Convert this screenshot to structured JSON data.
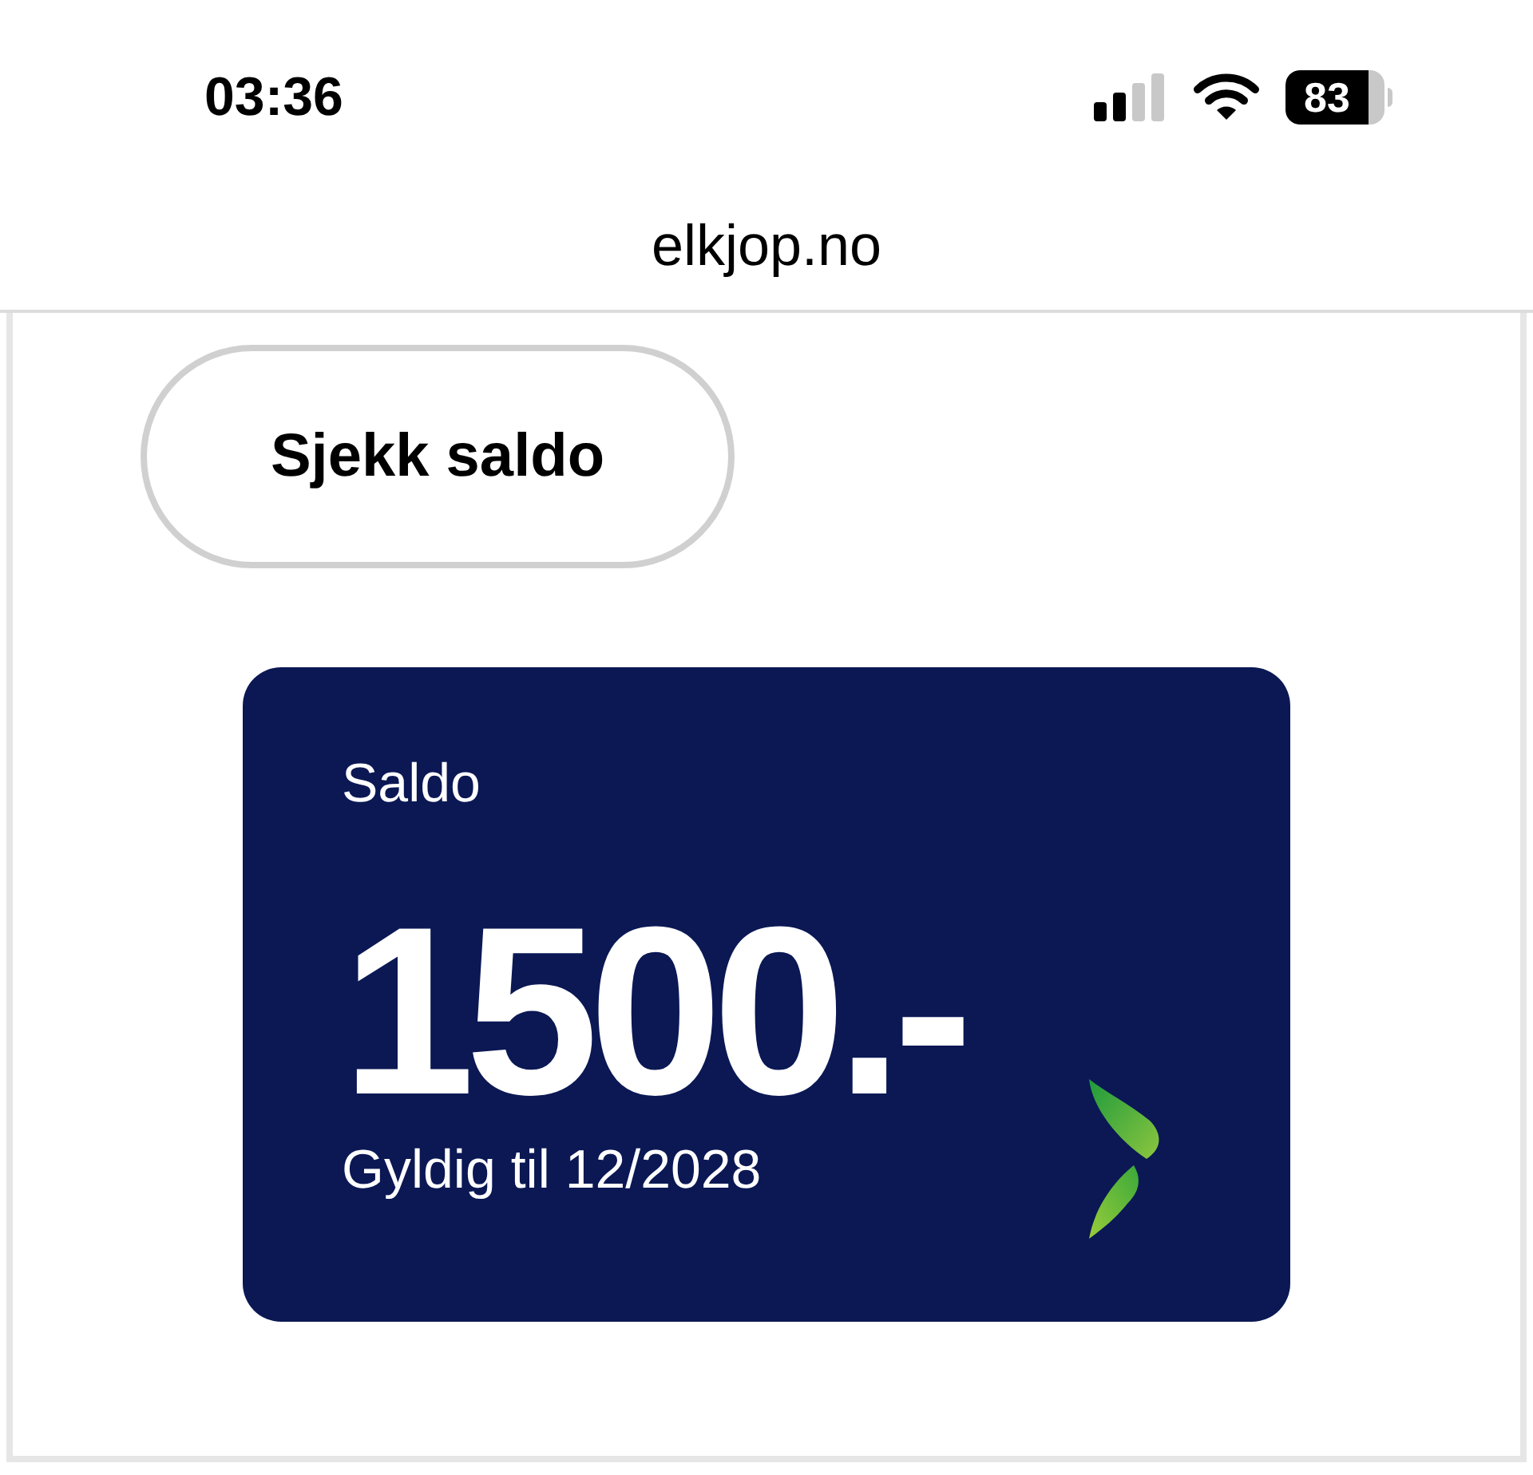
{
  "status_bar": {
    "time": "03:36",
    "battery": "83"
  },
  "address_bar": {
    "url": "elkjop.no"
  },
  "check_balance_button": {
    "label": "Sjekk saldo"
  },
  "gift_card": {
    "label": "Saldo",
    "amount": "1500.-",
    "validity": "Gyldig til 12/2028"
  }
}
